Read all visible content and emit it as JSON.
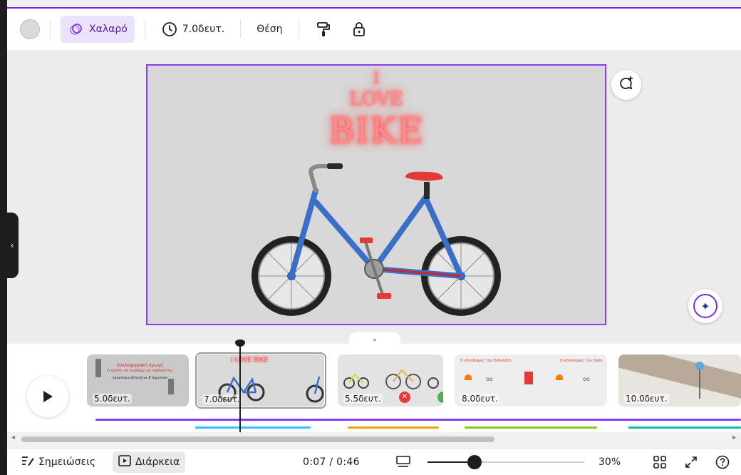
{
  "toolbar": {
    "animation_label": "Χαλαρό",
    "duration_label": "7.0δευτ.",
    "position_label": "Θέση",
    "icons": [
      "color-swatch",
      "animation-icon",
      "clock-icon",
      "paint-roller-icon",
      "lock-icon"
    ]
  },
  "slide": {
    "neon_line1": "I",
    "neon_line2": "LOVE",
    "neon_line3": "BIKE",
    "background": "#d8d8d8",
    "selection_color": "#8b3dff"
  },
  "timeline": {
    "scenes": [
      {
        "duration": "5.0δευτ.",
        "caption1": "Κυκλοφοριακή αγωγή",
        "caption2": "Τι πρέπει να προσέχω ως ποδηλάτης;",
        "caption3": "Εργαστήρια Δεξιοτήτων Β' Δημοτικού"
      },
      {
        "duration": "7.0δευτ.",
        "neon": "I LOVE BIKE"
      },
      {
        "duration": "5.5δευτ."
      },
      {
        "duration": "8.0δευτ.",
        "caption1": "Ο εξοπλισμός του Ποδηλάτη",
        "caption2": "Ο εξοπλισμός του Ποδη"
      },
      {
        "duration": "10.0δευτ."
      }
    ],
    "audio_colors": [
      "#8b3dff",
      "#38bdf8",
      "#f59e0b",
      "#84cc16",
      "#14b8a6"
    ]
  },
  "bottombar": {
    "notes_label": "Σημειώσεις",
    "duration_label": "Διάρκεια",
    "time": "0:07 / 0:46",
    "zoom_percent": "30%",
    "zoom_fraction": 0.3
  },
  "accent": "#7d2ae8"
}
